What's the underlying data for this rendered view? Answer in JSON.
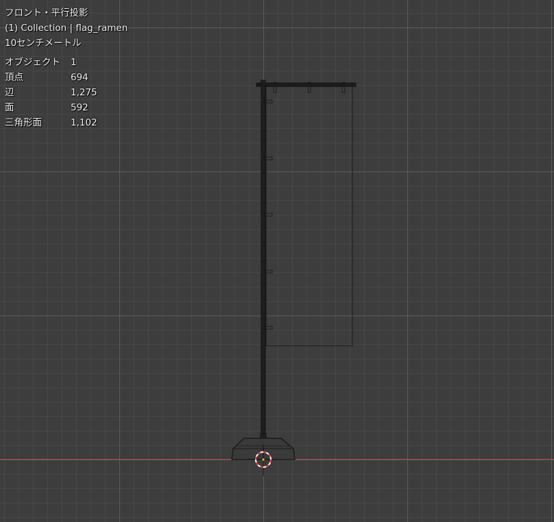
{
  "viewport": {
    "view_name": "フロント・平行投影",
    "collection": "(1) Collection",
    "separator": "|",
    "object_name": "flag_ramen",
    "grid_scale": "10センチメートル",
    "stats": [
      {
        "label": "オブジェクト",
        "value": "1"
      },
      {
        "label": "頂点",
        "value": "694"
      },
      {
        "label": "辺",
        "value": "1,275"
      },
      {
        "label": "面",
        "value": "592"
      },
      {
        "label": "三角形面",
        "value": "1,102"
      }
    ]
  },
  "colors": {
    "background": "#3d3d3d",
    "axis_x": "#a4484c",
    "wire": "#1a1a1a",
    "cursor_red": "#e03030",
    "cursor_white": "#ffffff"
  },
  "icons": {
    "cursor": "3d-cursor-icon"
  }
}
